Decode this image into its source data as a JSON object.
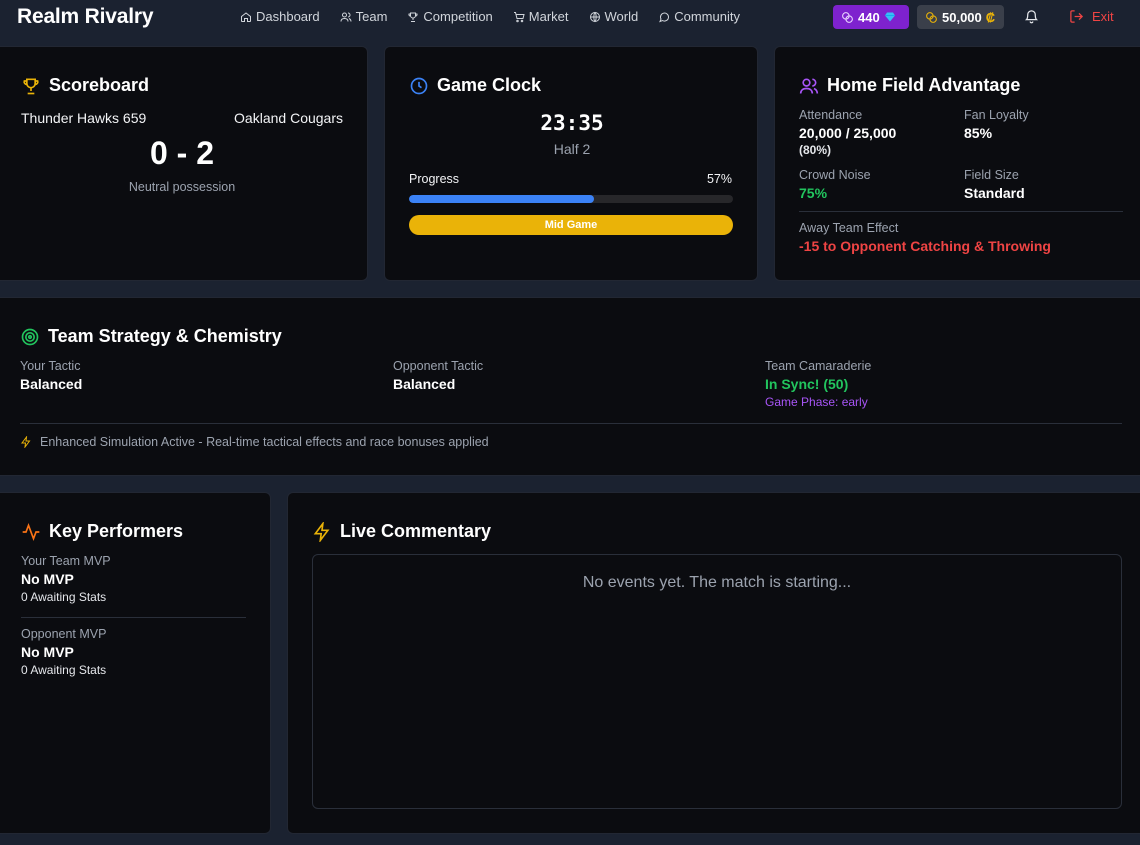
{
  "app": {
    "title": "Realm Rivalry"
  },
  "nav": {
    "items": [
      {
        "label": "Dashboard",
        "icon": "home-icon"
      },
      {
        "label": "Team",
        "icon": "users-icon"
      },
      {
        "label": "Competition",
        "icon": "trophy-icon"
      },
      {
        "label": "Market",
        "icon": "cart-icon"
      },
      {
        "label": "World",
        "icon": "globe-icon"
      },
      {
        "label": "Community",
        "icon": "chat-icon"
      }
    ]
  },
  "currency": {
    "gems": "440",
    "credits": "50,000",
    "credit_symbol": "₡"
  },
  "exit_label": "Exit",
  "scoreboard": {
    "title": "Scoreboard",
    "home_team": "Thunder Hawks 659",
    "away_team": "Oakland Cougars",
    "score": "0 - 2",
    "possession": "Neutral possession"
  },
  "clock": {
    "title": "Game Clock",
    "time": "23:35",
    "half": "Half 2",
    "progress_label": "Progress",
    "progress_text": "57%",
    "progress_value": 0.57,
    "phase_badge": "Mid Game"
  },
  "home_field": {
    "title": "Home Field Advantage",
    "attendance_label": "Attendance",
    "attendance_value": "20,000 / 25,000",
    "attendance_pct": "(80%)",
    "fan_loyalty_label": "Fan Loyalty",
    "fan_loyalty_value": "85%",
    "crowd_noise_label": "Crowd Noise",
    "crowd_noise_value": "75%",
    "field_size_label": "Field Size",
    "field_size_value": "Standard",
    "away_effect_label": "Away Team Effect",
    "away_effect_value": "-15 to Opponent Catching & Throwing"
  },
  "strategy": {
    "title": "Team Strategy & Chemistry",
    "your_tactic_label": "Your Tactic",
    "your_tactic_value": "Balanced",
    "opp_tactic_label": "Opponent Tactic",
    "opp_tactic_value": "Balanced",
    "camaraderie_label": "Team Camaraderie",
    "camaraderie_value": "In Sync! (50)",
    "game_phase": "Game Phase: early",
    "sim_note": "Enhanced Simulation Active - Real-time tactical effects and race bonuses applied"
  },
  "performers": {
    "title": "Key Performers",
    "your_mvp_label": "Your Team MVP",
    "your_mvp_name": "No MVP",
    "your_mvp_stats": "0 Awaiting Stats",
    "opp_mvp_label": "Opponent MVP",
    "opp_mvp_name": "No MVP",
    "opp_mvp_stats": "0 Awaiting Stats"
  },
  "commentary": {
    "title": "Live Commentary",
    "empty": "No events yet. The match is starting..."
  },
  "colors": {
    "accent_yellow": "#eab308",
    "accent_blue": "#3b82f6",
    "accent_purple": "#a855f7",
    "accent_green": "#22c55e",
    "accent_red": "#ef4444",
    "accent_orange": "#f97316"
  }
}
